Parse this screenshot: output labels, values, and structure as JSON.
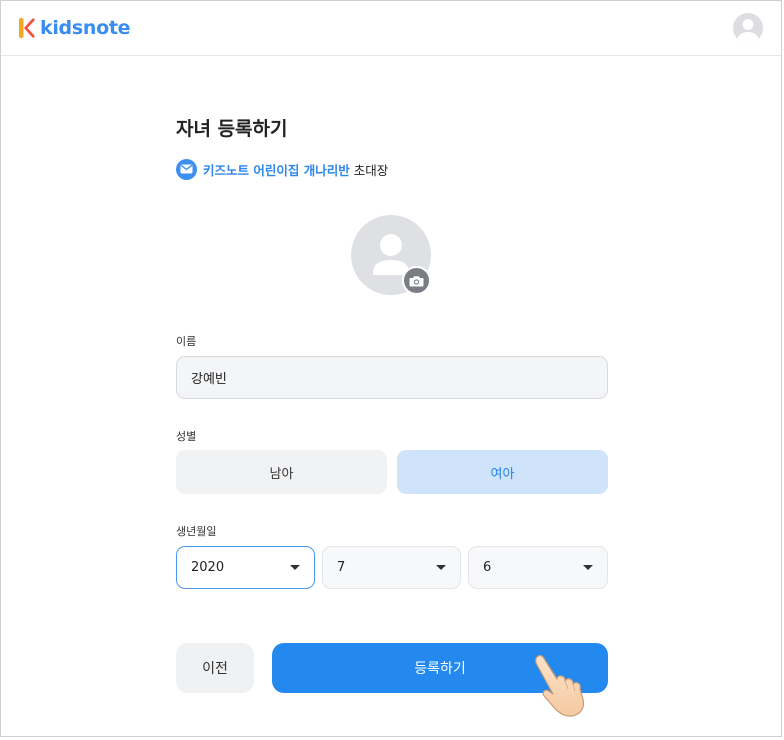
{
  "header": {
    "logo_text": "kidsnote",
    "brand_color": "#3a8df0",
    "user_icon": "user-avatar-icon"
  },
  "form": {
    "title": "자녀 등록하기",
    "invite": {
      "icon": "envelope-icon",
      "org_name": "키즈노트 어린이집 개나리반",
      "suffix": "초대장"
    },
    "photo": {
      "placeholder_icon": "person-silhouette-icon",
      "camera_icon": "camera-icon"
    },
    "name": {
      "label": "이름",
      "value": "강예빈"
    },
    "gender": {
      "label": "성별",
      "options": [
        "남아",
        "여아"
      ],
      "selected": "여아"
    },
    "birthdate": {
      "label": "생년월일",
      "year": "2020",
      "month": "7",
      "day": "6",
      "focused": "year"
    },
    "buttons": {
      "prev_label": "이전",
      "submit_label": "등록하기"
    }
  },
  "colors": {
    "accent": "#2389ef",
    "selected_bg": "#cfe4fb",
    "focus_border": "#4a97ee"
  }
}
